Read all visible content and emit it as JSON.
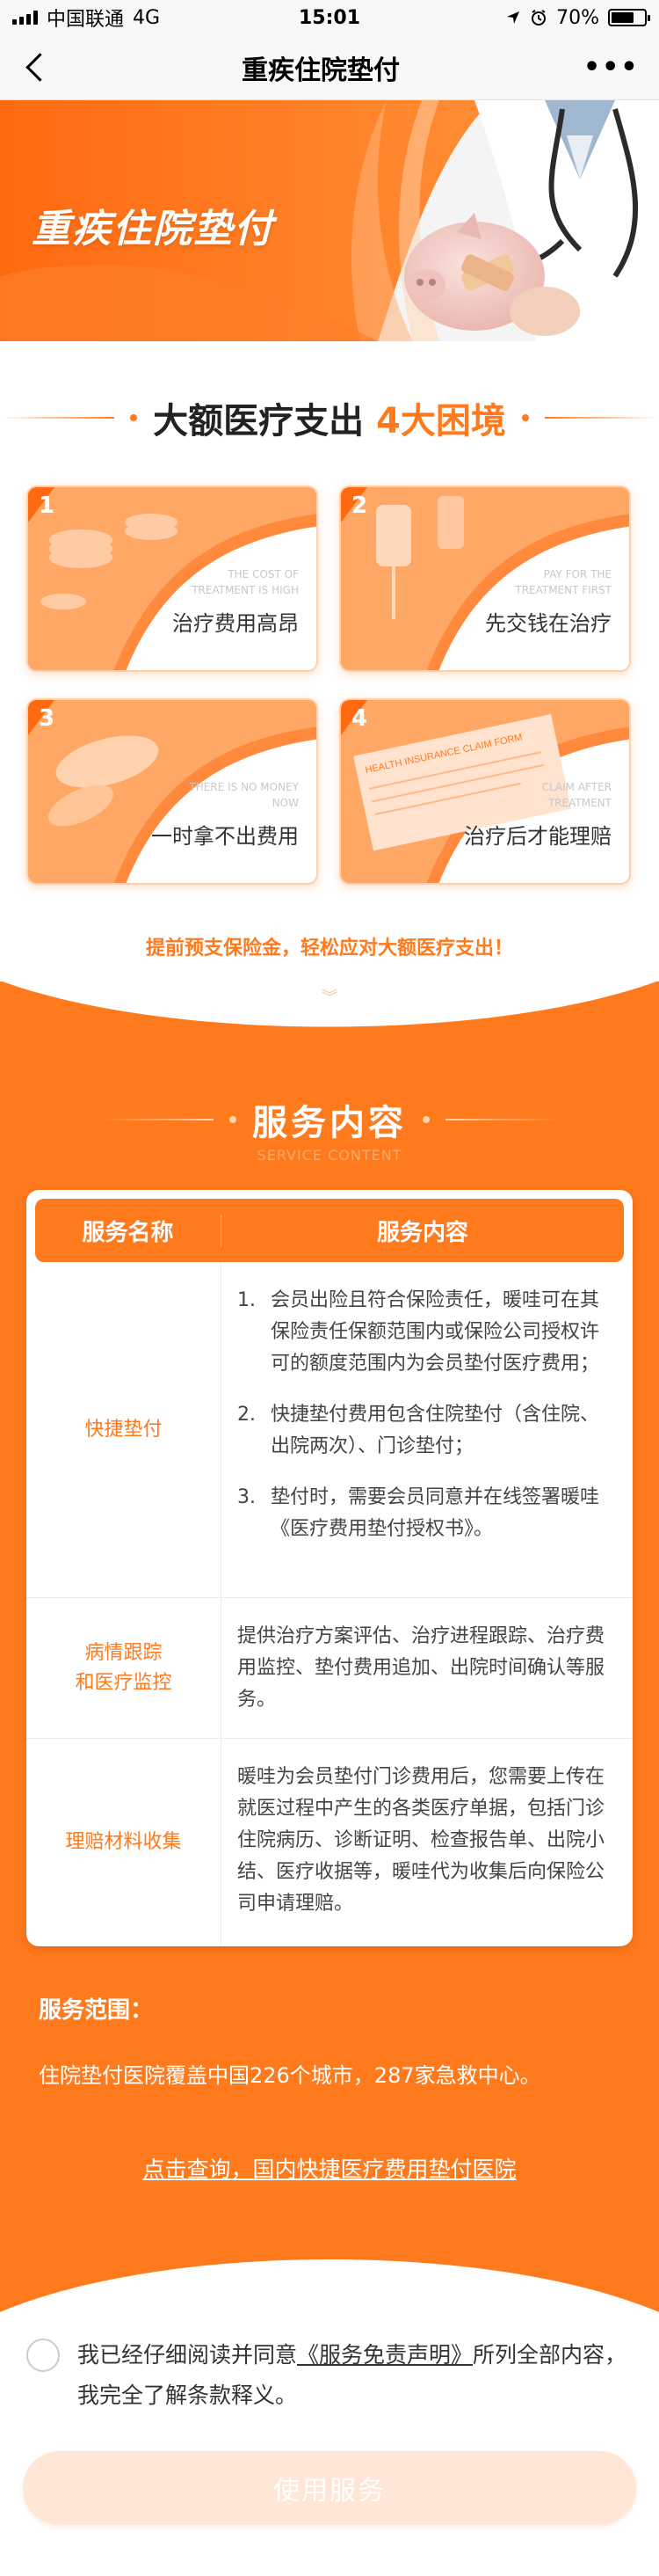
{
  "status_bar": {
    "carrier": "中国联通",
    "network": "4G",
    "time": "15:01",
    "battery": "70%",
    "battery_level": 0.7
  },
  "nav": {
    "title": "重疾住院垫付",
    "more": "•••"
  },
  "banner": {
    "title": "重疾住院垫付"
  },
  "dilemma": {
    "title_black": "大额医疗支出",
    "title_orange": "4大困境",
    "cards": [
      {
        "num": "1",
        "en": "THE COST OF TREATMENT IS HIGH",
        "cn": "治疗费用高昂"
      },
      {
        "num": "2",
        "en": "PAY FOR THE TREATMENT FIRST",
        "cn": "先交钱在治疗"
      },
      {
        "num": "3",
        "en": "THERE IS NO MONEY NOW",
        "cn": "一时拿不出费用"
      },
      {
        "num": "4",
        "en": "CLAIM AFTER TREATMENT",
        "cn": "治疗后才能理赔"
      }
    ],
    "card4_form_text": "HEALTH INSURANCE CLAIM FORM",
    "tagline": "提前预支保险金，轻松应对大额医疗支出！"
  },
  "service": {
    "title": "服务内容",
    "subtitle": "SERVICE CONTENT",
    "headers": {
      "name": "服务名称",
      "content": "服务内容"
    },
    "rows": [
      {
        "name": "快捷垫付",
        "items": [
          {
            "n": "1.",
            "text": "会员出险且符合保险责任，暖哇可在其保险责任保额范围内或保险公司授权许可的额度范围内为会员垫付医疗费用；"
          },
          {
            "n": "2.",
            "text": "快捷垫付费用包含住院垫付（含住院、出院两次）、门诊垫付；"
          },
          {
            "n": "3.",
            "text": "垫付时，需要会员同意并在线签署暖哇《医疗费用垫付授权书》。"
          }
        ]
      },
      {
        "name_line1": "病情跟踪",
        "name_line2": "和医疗监控",
        "text": "提供治疗方案评估、治疗进程跟踪、治疗费用监控、垫付费用追加、出院时间确认等服务。"
      },
      {
        "name": "理赔材料收集",
        "text": "暖哇为会员垫付门诊费用后，您需要上传在就医过程中产生的各类医疗单据，包括门诊住院病历、诊断证明、检查报告单、出院小结、医疗收据等，暖哇代为收集后向保险公司申请理赔。"
      }
    ],
    "scope_title": "服务范围：",
    "scope_text": "住院垫付医院覆盖中国226个城市，287家急救中心。",
    "scope_link": "点击查询，国内快捷医疗费用垫付医院"
  },
  "agreement": {
    "prefix": "我已经仔细阅读并同意",
    "link": "《服务免责声明》",
    "suffix": "所列全部内容，我完全了解条款释义。"
  },
  "button": {
    "label": "使用服务"
  },
  "colors": {
    "accent": "#ff7a1d",
    "button_disabled": "#ffe6d6"
  }
}
